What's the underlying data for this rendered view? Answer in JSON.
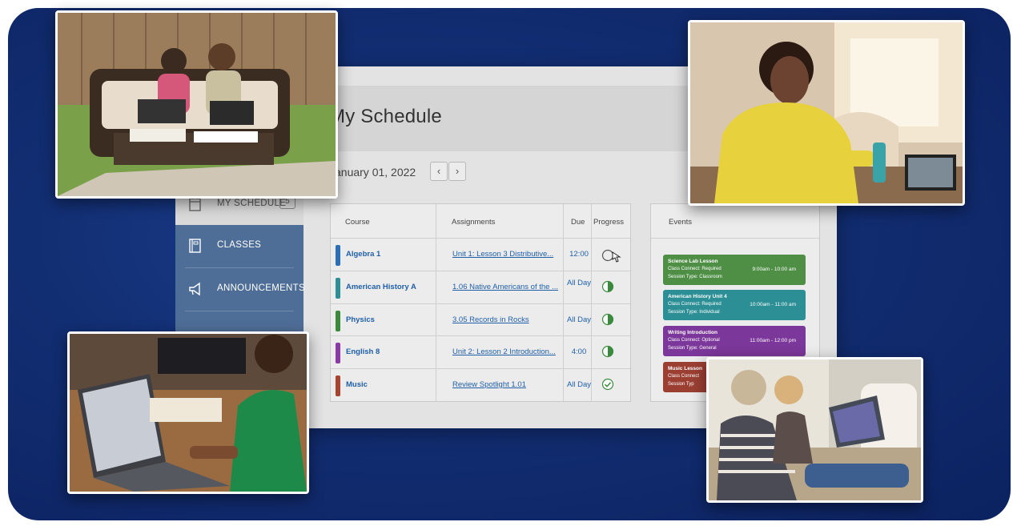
{
  "app": {
    "page_title": "My Schedule",
    "date": "January 01, 2022",
    "prev_icon": "chevron-left-icon",
    "next_icon": "chevron-right-icon"
  },
  "sidebar": {
    "items": [
      {
        "label": "MY SCHEDULE",
        "badge": "5",
        "icon": "calendar-icon",
        "active": true
      },
      {
        "label": "CLASSES",
        "icon": "book-icon",
        "active": false
      },
      {
        "label": "ANNOUNCEMENTS",
        "icon": "megaphone-icon",
        "active": false
      }
    ]
  },
  "schedule": {
    "headers": {
      "course": "Course",
      "assignments": "Assignments",
      "due": "Due",
      "progress": "Progress"
    },
    "rows": [
      {
        "course": "Algebra 1",
        "color": "#2a6fb8",
        "assignment": "Unit 1: Lesson 3 Distributive...",
        "due": "12:00",
        "progress": "not-started"
      },
      {
        "course": "American History A",
        "color": "#2b8f95",
        "assignment": "1.06 Native Americans of the ...",
        "due": "All Day",
        "progress": "half"
      },
      {
        "course": "Physics",
        "color": "#3a8a3e",
        "assignment": "3.05 Records in Rocks",
        "due": "All Day",
        "progress": "half"
      },
      {
        "course": "English 8",
        "color": "#8a3aa6",
        "assignment": "Unit 2: Lesson 2 Introduction...",
        "due": "4:00",
        "progress": "half"
      },
      {
        "course": "Music",
        "color": "#a8432f",
        "assignment": "Review Spotlight 1.01",
        "due": "All Day",
        "progress": "complete"
      }
    ]
  },
  "events": {
    "header": "Events",
    "items": [
      {
        "title": "Science Lab Lesson",
        "line1": "Class Connect: Required",
        "line2": "Session Type: Classroom",
        "time": "9:00am - 10:00 am",
        "color": "#4e8f45"
      },
      {
        "title": "American History Unit 4",
        "line1": "Class Connect: Required",
        "line2": "Session Type: Individual",
        "time": "10:00am - 11:00 am",
        "color": "#2b8f95"
      },
      {
        "title": "Writing Introduction",
        "line1": "Class Connect: Optional",
        "line2": "Session Type: General",
        "time": "11:00am - 12:00 pm",
        "color": "#7b3799"
      },
      {
        "title": "Music Lesson",
        "line1": "Class Connect",
        "line2": "Session Typ",
        "time": "",
        "color": "#9b3f33"
      }
    ]
  },
  "colors": {
    "background": "#122e72",
    "sidebar": "#4f6e97",
    "link": "#1f5fa8",
    "progress": "#3a8a3e"
  }
}
